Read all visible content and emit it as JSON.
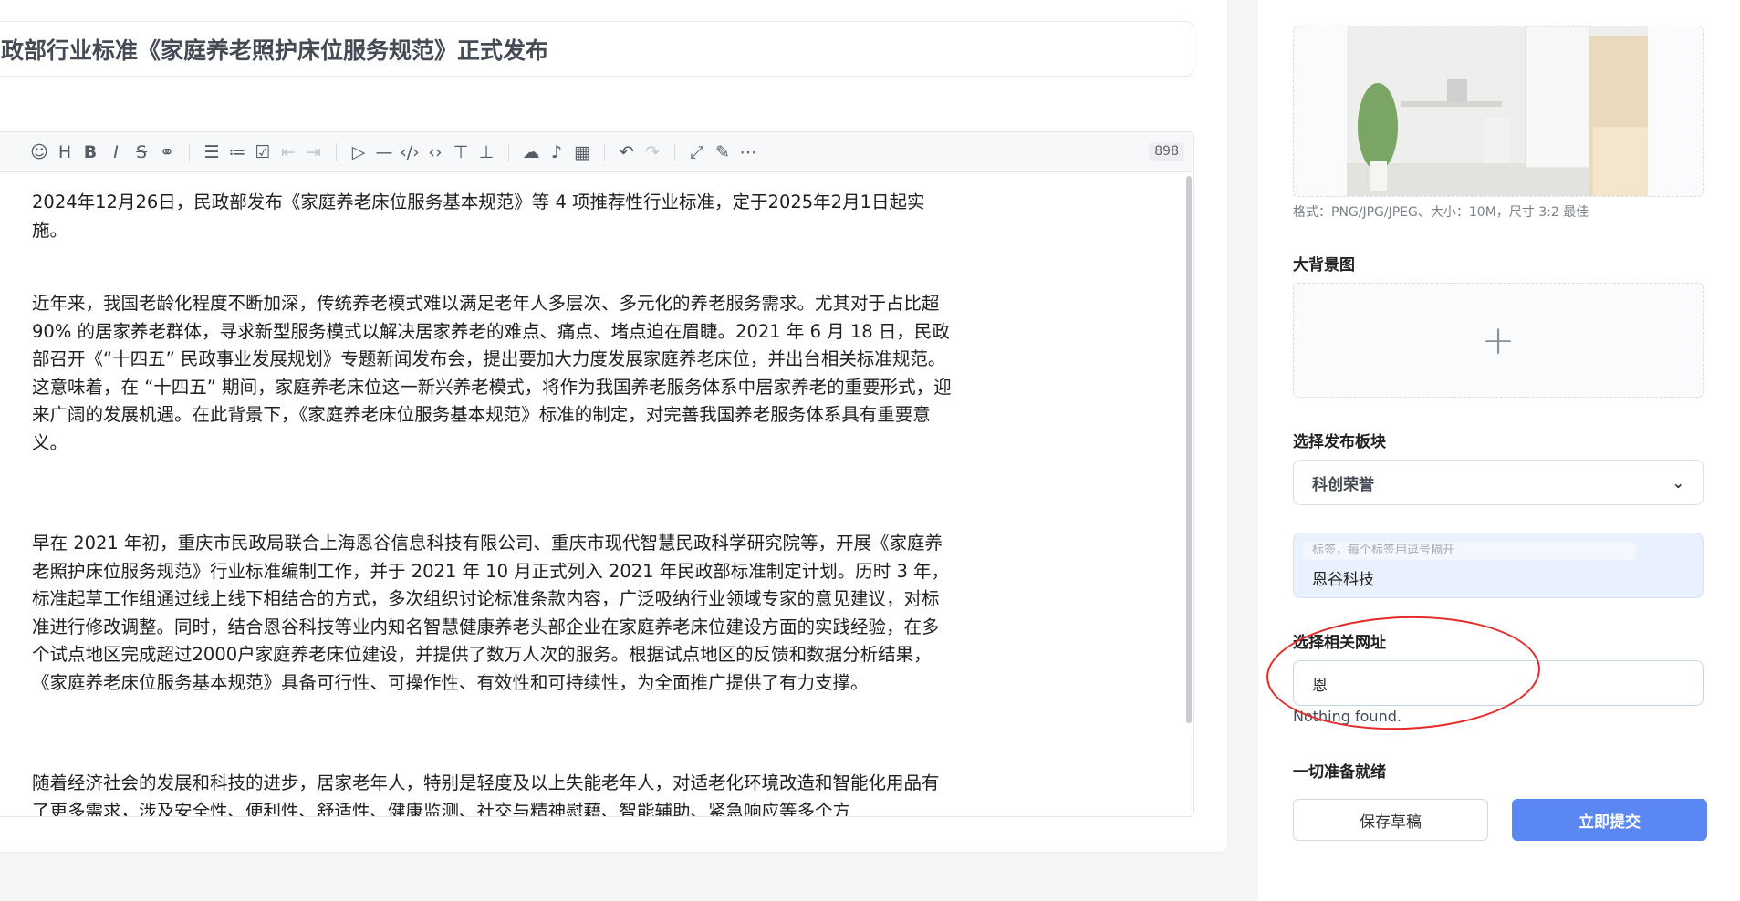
{
  "article": {
    "title": "政部行业标准《家庭养老照护床位服务规范》正式发布",
    "word_count": "898",
    "paragraphs": [
      "2024年12月26日，民政部发布《家庭养老床位服务基本规范》等 4 项推荐性行业标准，定于2025年2月1日起实施。",
      "近年来，我国老龄化程度不断加深，传统养老模式难以满足老年人多层次、多元化的养老服务需求。尤其对于占比超 90% 的居家养老群体，寻求新型服务模式以解决居家养老的难点、痛点、堵点迫在眉睫。2021 年 6 月 18 日，民政部召开《“十四五” 民政事业发展规划》专题新闻发布会，提出要加大力度发展家庭养老床位，并出台相关标准规范。这意味着，在 “十四五” 期间，家庭养老床位这一新兴养老模式，将作为我国养老服务体系中居家养老的重要形式，迎来广阔的发展机遇。在此背景下，《家庭养老床位服务基本规范》标准的制定，对完善我国养老服务体系具有重要意义。",
      "早在 2021 年初，重庆市民政局联合上海恩谷信息科技有限公司、重庆市现代智慧民政科学研究院等，开展《家庭养老照护床位服务规范》行业标准编制工作，并于 2021 年 10 月正式列入 2021 年民政部标准制定计划。历时 3 年，标准起草工作组通过线上线下相结合的方式，多次组织讨论标准条款内容，广泛吸纳行业领域专家的意见建议，对标准进行修改调整。同时，结合恩谷科技等业内知名智慧健康养老头部企业在家庭养老床位建设方面的实践经验，在多个试点地区完成超过2000户家庭养老床位建设，并提供了数万人次的服务。根据试点地区的反馈和数据分析结果，《家庭养老床位服务基本规范》具备可行性、可操作性、有效性和可持续性，为全面推广提供了有力支撑。",
      "随着经济社会的发展和科技的进步，居家老年人，特别是轻度及以上失能老年人，对适老化环境改造和智能化用品有了更多需求，涉及安全性、便利性、舒适性、健康监测、社交与精神慰藉、智能辅助、紧急响应等多个方"
    ]
  },
  "toolbar": {
    "icons": [
      "emoji-icon",
      "heading-icon",
      "bold-icon",
      "italic-icon",
      "strikethrough-icon",
      "link-icon",
      "unordered-list-icon",
      "ordered-list-icon",
      "checklist-icon",
      "outdent-icon",
      "indent-icon",
      "quote-icon",
      "horizontal-rule-icon",
      "code-icon",
      "inline-code-icon",
      "insert-before-icon",
      "insert-after-icon",
      "upload-icon",
      "record-icon",
      "table-icon",
      "undo-icon",
      "redo-icon",
      "fullscreen-icon",
      "edit-mode-icon",
      "more-icon"
    ]
  },
  "sidebar": {
    "image_hint": "格式：PNG/JPG/JPEG、大小：10M，尺寸 3:2 最佳",
    "bg_label": "大背景图",
    "section_label": "选择发布板块",
    "section_selected": "科创荣誉",
    "tag_placeholder": "标签，每个标签用逗号隔开",
    "tag_chip": "恩谷科技",
    "url_label": "选择相关网址",
    "url_value": "恩",
    "url_empty": "Nothing found.",
    "ready_label": "一切准备就绪",
    "draft_button": "保存草稿",
    "submit_button": "立即提交"
  },
  "colors": {
    "accent": "#5b87f2",
    "annotation": "#e52a2a",
    "tag_bg": "#e8f1fd"
  }
}
